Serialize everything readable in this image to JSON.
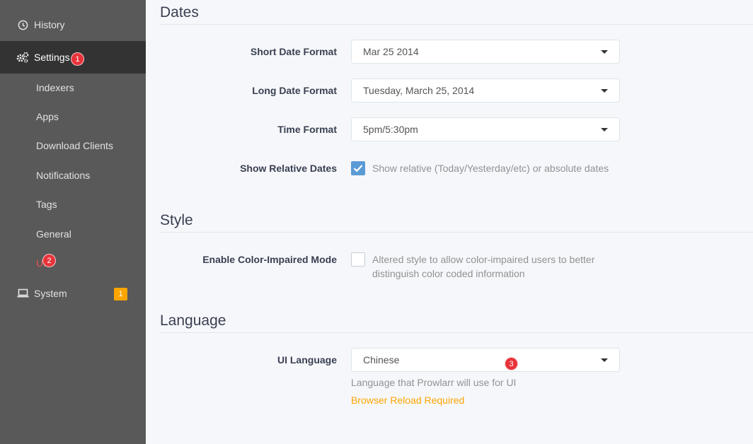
{
  "sidebar": {
    "history": "History",
    "settings": "Settings",
    "sub_items": [
      "Indexers",
      "Apps",
      "Download Clients",
      "Notifications",
      "Tags",
      "General",
      "UI"
    ],
    "system": "System",
    "system_badge": "1"
  },
  "annotations": {
    "one": "1",
    "two": "2",
    "three": "3"
  },
  "dates": {
    "title": "Dates",
    "short_date_label": "Short Date Format",
    "short_date_value": "Mar 25 2014",
    "long_date_label": "Long Date Format",
    "long_date_value": "Tuesday, March 25, 2014",
    "time_label": "Time Format",
    "time_value": "5pm/5:30pm",
    "relative_label": "Show Relative Dates",
    "relative_help": "Show relative (Today/Yesterday/etc) or absolute dates",
    "relative_checked": true
  },
  "style": {
    "title": "Style",
    "color_label": "Enable Color-Impaired Mode",
    "color_help_line1": "Altered style to allow color-impaired users to better",
    "color_help_line2": "distinguish color coded information",
    "color_checked": false
  },
  "language": {
    "title": "Language",
    "ui_language_label": "UI Language",
    "ui_language_value": "Chinese",
    "ui_language_help": "Language that Prowlarr will use for UI",
    "reload_warning": "Browser Reload Required"
  },
  "colors": {
    "sidebar": "#595959",
    "active": "#333333",
    "accent_red": "#f05050",
    "warning": "#ffa500",
    "checkbox": "#5b9bd5"
  }
}
